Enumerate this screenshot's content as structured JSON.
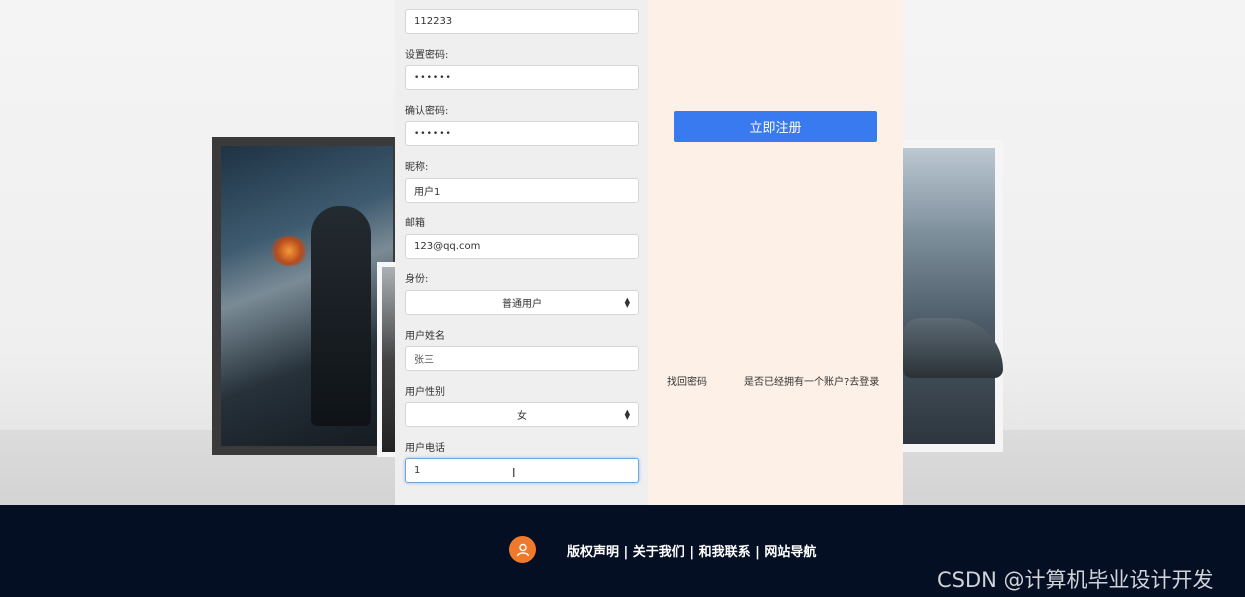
{
  "form": {
    "top_label": "",
    "account_value": "112233",
    "password_label": "设置密码:",
    "password_value": "••••••",
    "confirm_label": "确认密码:",
    "confirm_value": "••••••",
    "nickname_label": "昵称:",
    "nickname_value": "用户1",
    "email_label": "邮箱",
    "email_value": "123@qq.com",
    "identity_label": "身份:",
    "identity_selected": "普通用户",
    "realname_label": "用户姓名",
    "realname_placeholder": "张三",
    "gender_label": "用户性别",
    "gender_selected": "女",
    "phone_label": "用户电话",
    "phone_value": "1",
    "select_arrow": "▲▼"
  },
  "right_panel": {
    "register_button": "立即注册",
    "forgot_password": "找回密码",
    "have_account": "是否已经拥有一个账户?去登录"
  },
  "footer": {
    "links": "版权声明 | 关于我们 | 和我联系 | 网站导航",
    "watermark": "CSDN @计算机毕业设计开发"
  },
  "colors": {
    "primary_button": "#3a7af0",
    "footer_bg": "#050f24",
    "footer_icon": "#f07a2b",
    "right_panel_bg": "#fdf0e7"
  },
  "icons": {
    "footer_icon": "user-icon",
    "cursor": "text-cursor-icon"
  }
}
